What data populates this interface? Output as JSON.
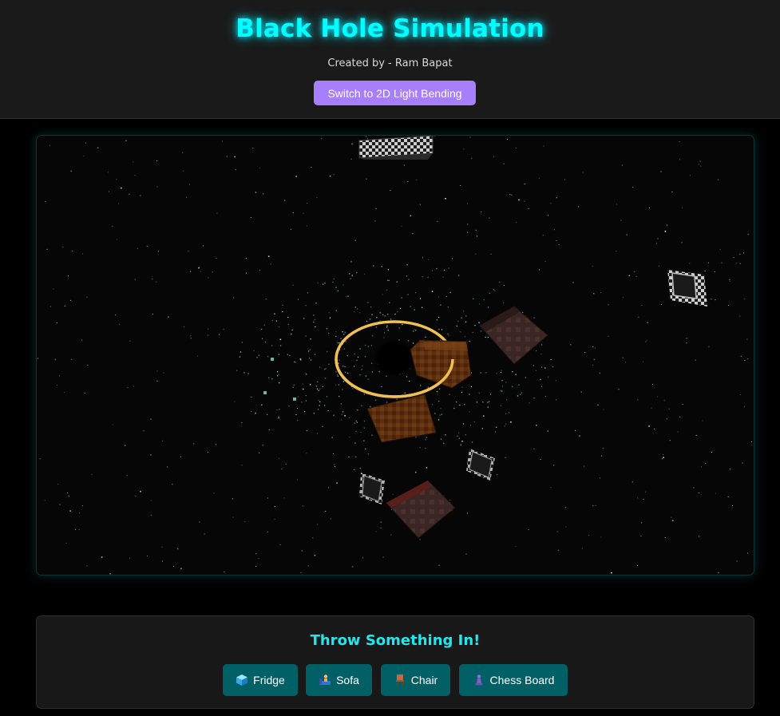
{
  "header": {
    "title": "Black Hole Simulation",
    "credit": "Created by - Ram Bapat",
    "switch_label": "Switch to 2D Light Bending"
  },
  "panel": {
    "title": "Throw Something In!",
    "buttons": [
      {
        "label": "Fridge",
        "icon": "ice-cube-icon"
      },
      {
        "label": "Sofa",
        "icon": "person-on-sofa-icon"
      },
      {
        "label": "Chair",
        "icon": "chair-icon"
      },
      {
        "label": "Chess Board",
        "icon": "chess-pawn-icon"
      }
    ]
  },
  "colors": {
    "accent_cyan": "#00ffff",
    "switch_button": "#a87ffb",
    "object_button": "#006066",
    "accretion_ring": "#f0c050"
  }
}
